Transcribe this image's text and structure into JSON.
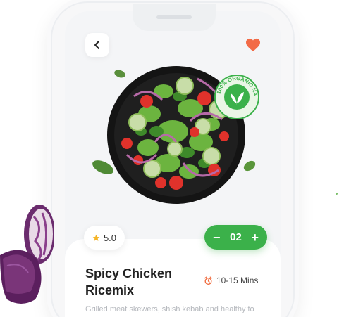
{
  "nav": {
    "back_icon": "chevron-left-icon",
    "favorite_icon": "heart-icon"
  },
  "badge": {
    "text": "100% ORGANIC NATURAL"
  },
  "product": {
    "rating": "5.0",
    "quantity": "02",
    "decrement": "−",
    "increment": "+",
    "title": "Spicy Chicken Ricemix",
    "time": "10-15 Mins",
    "description": "Grilled meat skewers, shish kebab and healthy to"
  },
  "colors": {
    "accent": "#3bb14a",
    "heart": "#f26b47",
    "star": "#f5b529",
    "clock": "#f06a3c"
  }
}
